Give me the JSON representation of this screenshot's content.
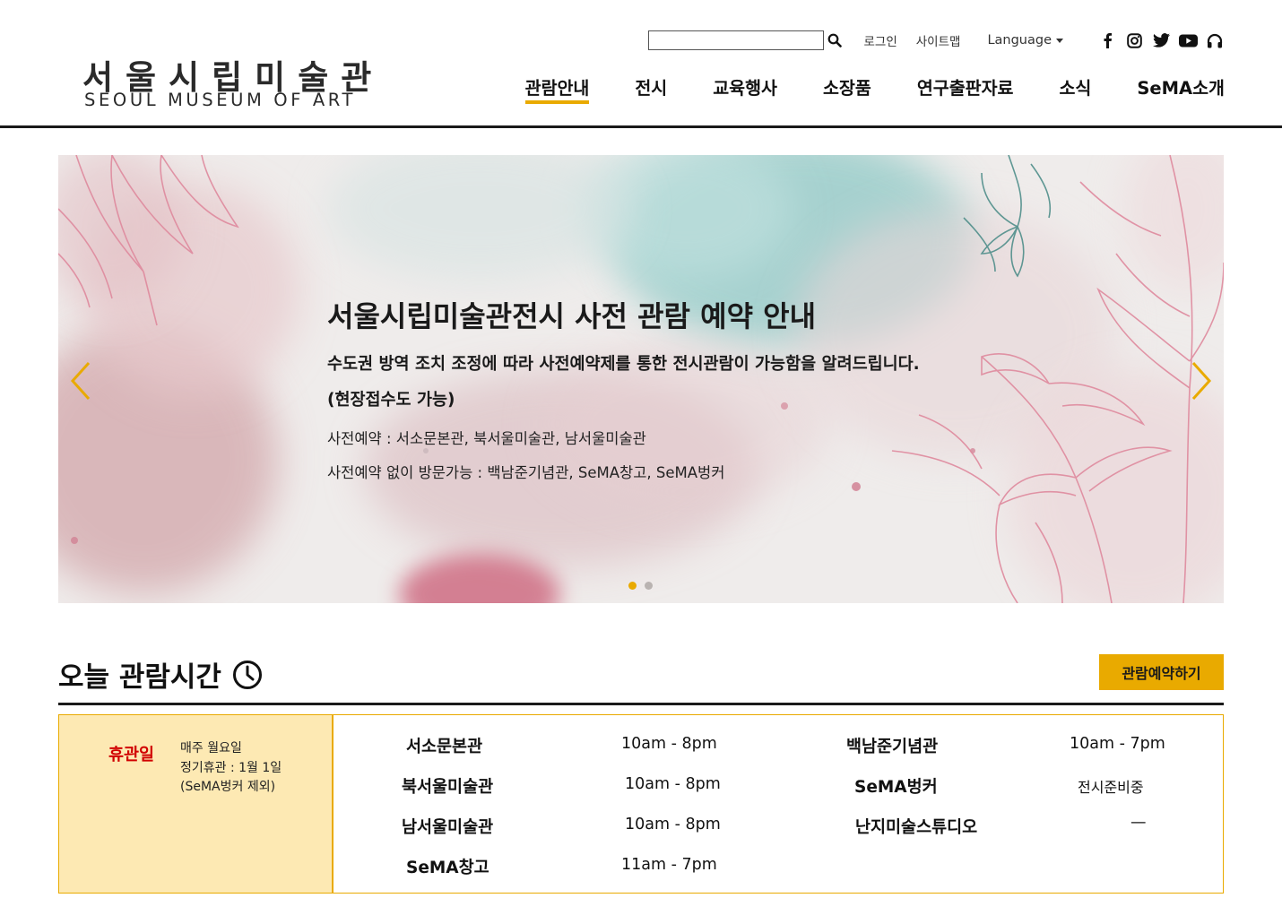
{
  "header": {
    "logo_ko": "서울시립미술관",
    "logo_en": "SEOUL MUSEUM OF ART",
    "search": {
      "value": "",
      "placeholder": ""
    },
    "util_links": [
      "로그인",
      "사이트맵"
    ],
    "language_label": "Language",
    "social": [
      "facebook-icon",
      "instagram-icon",
      "twitter-icon",
      "youtube-icon",
      "headphones-icon"
    ],
    "nav": [
      "관람안내",
      "전시",
      "교육행사",
      "소장품",
      "연구출판자료",
      "소식",
      "SeMA소개"
    ],
    "active_nav": "관람안내"
  },
  "hero": {
    "title": "서울시립미술관전시 사전 관람 예약 안내",
    "line1": "수도권 방역 조치 조정에 따라 사전예약제를 통한 전시관람이 가능함을 알려드립니다.",
    "line2": "(현장접수도 가능)",
    "sub1": "사전예약 : 서소문본관, 북서울미술관, 남서울미술관",
    "sub2": "사전예약 없이 방문가능 : 백남준기념관, SeMA창고, SeMA벙커",
    "slides": 2,
    "current_slide": 1
  },
  "today": {
    "title": "오늘 관람시간",
    "reserve_label": "관람예약하기",
    "closed": {
      "label": "휴관일",
      "notes": [
        "매주 월요일",
        "정기휴관 : 1월 1일",
        "(SeMA벙커 제외)"
      ]
    },
    "venues": [
      {
        "name": "서소문본관",
        "time": "10am - 8pm"
      },
      {
        "name": "북서울미술관",
        "time": "10am - 8pm"
      },
      {
        "name": "남서울미술관",
        "time": "10am - 8pm"
      },
      {
        "name": "SeMA창고",
        "time": "11am - 7pm"
      },
      {
        "name": "백남준기념관",
        "time": "10am - 7pm"
      },
      {
        "name": "SeMA벙커",
        "time": "전시준비중"
      },
      {
        "name": "난지미술스튜디오",
        "time": "—"
      }
    ]
  },
  "colors": {
    "accent": "#e9aa00",
    "closed_bg": "#fde9b3",
    "closed_text": "#d10000",
    "rule": "#1a1a1a"
  }
}
